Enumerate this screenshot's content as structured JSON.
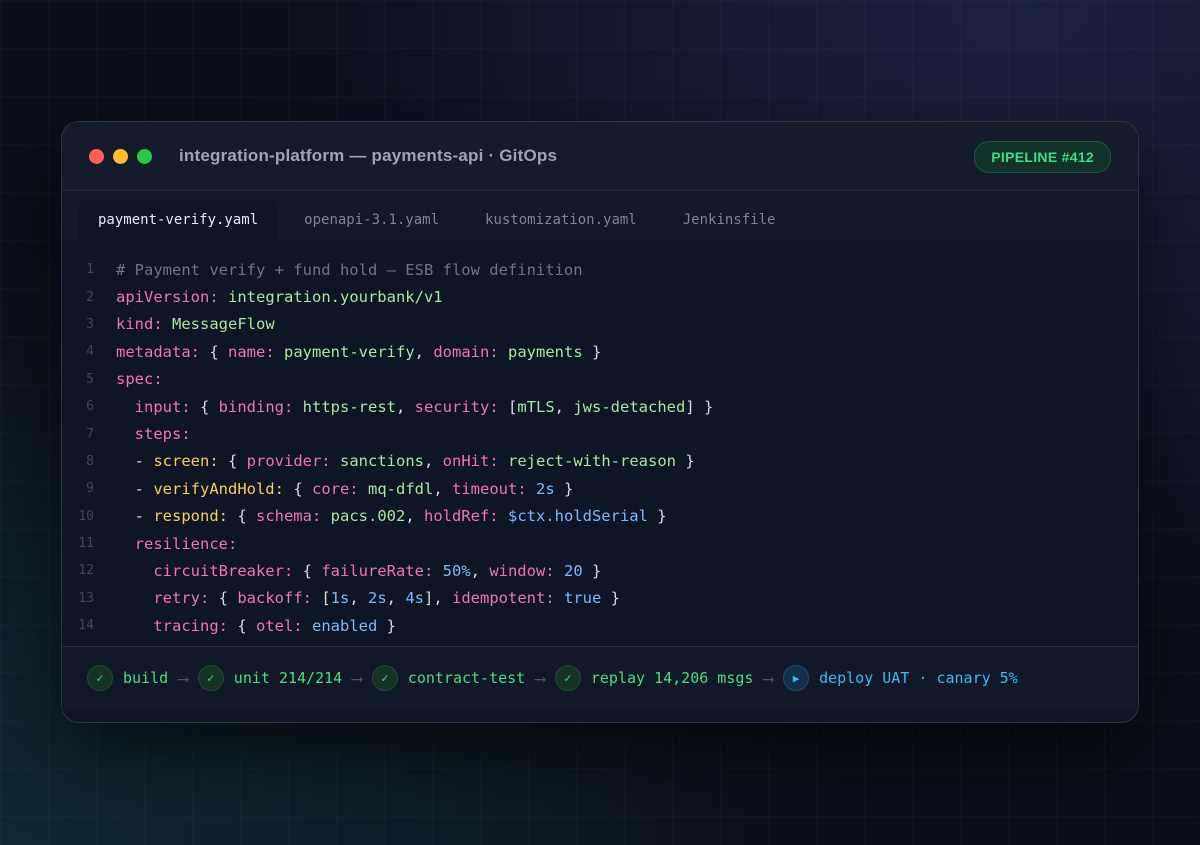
{
  "window": {
    "title": "integration-platform — payments-api · GitOps",
    "badge": "PIPELINE #412"
  },
  "tabs": [
    {
      "label": "payment-verify.yaml",
      "active": true
    },
    {
      "label": "openapi-3.1.yaml",
      "active": false
    },
    {
      "label": "kustomization.yaml",
      "active": false
    },
    {
      "label": "Jenkinsfile",
      "active": false
    }
  ],
  "code": {
    "line_numbers": [
      "1",
      "2",
      "3",
      "4",
      "5",
      "6",
      "7",
      "8",
      "9",
      "10",
      "11",
      "12",
      "13",
      "14"
    ],
    "lines": [
      [
        {
          "t": "comment",
          "v": "# Payment verify + fund hold — ESB flow definition"
        }
      ],
      [
        {
          "t": "key",
          "v": "apiVersion:"
        },
        {
          "t": "punc",
          "v": " "
        },
        {
          "t": "val",
          "v": "integration.yourbank/v1"
        }
      ],
      [
        {
          "t": "key",
          "v": "kind:"
        },
        {
          "t": "punc",
          "v": " "
        },
        {
          "t": "val",
          "v": "MessageFlow"
        }
      ],
      [
        {
          "t": "key",
          "v": "metadata:"
        },
        {
          "t": "punc",
          "v": " { "
        },
        {
          "t": "key",
          "v": "name:"
        },
        {
          "t": "punc",
          "v": " "
        },
        {
          "t": "val",
          "v": "payment-verify"
        },
        {
          "t": "punc",
          "v": ", "
        },
        {
          "t": "key",
          "v": "domain:"
        },
        {
          "t": "punc",
          "v": " "
        },
        {
          "t": "val",
          "v": "payments"
        },
        {
          "t": "punc",
          "v": " }"
        }
      ],
      [
        {
          "t": "key",
          "v": "spec:"
        }
      ],
      [
        {
          "t": "punc",
          "v": "  "
        },
        {
          "t": "key",
          "v": "input:"
        },
        {
          "t": "punc",
          "v": " { "
        },
        {
          "t": "key",
          "v": "binding:"
        },
        {
          "t": "punc",
          "v": " "
        },
        {
          "t": "val",
          "v": "https-rest"
        },
        {
          "t": "punc",
          "v": ", "
        },
        {
          "t": "key",
          "v": "security:"
        },
        {
          "t": "punc",
          "v": " ["
        },
        {
          "t": "val",
          "v": "mTLS"
        },
        {
          "t": "punc",
          "v": ", "
        },
        {
          "t": "val",
          "v": "jws-detached"
        },
        {
          "t": "punc",
          "v": "] }"
        }
      ],
      [
        {
          "t": "punc",
          "v": "  "
        },
        {
          "t": "key",
          "v": "steps:"
        }
      ],
      [
        {
          "t": "punc",
          "v": "  - "
        },
        {
          "t": "step",
          "v": "screen:"
        },
        {
          "t": "punc",
          "v": " { "
        },
        {
          "t": "key",
          "v": "provider:"
        },
        {
          "t": "punc",
          "v": " "
        },
        {
          "t": "val",
          "v": "sanctions"
        },
        {
          "t": "punc",
          "v": ", "
        },
        {
          "t": "key",
          "v": "onHit:"
        },
        {
          "t": "punc",
          "v": " "
        },
        {
          "t": "val",
          "v": "reject-with-reason"
        },
        {
          "t": "punc",
          "v": " }"
        }
      ],
      [
        {
          "t": "punc",
          "v": "  - "
        },
        {
          "t": "step",
          "v": "verifyAndHold:"
        },
        {
          "t": "punc",
          "v": " { "
        },
        {
          "t": "key",
          "v": "core:"
        },
        {
          "t": "punc",
          "v": " "
        },
        {
          "t": "val",
          "v": "mq-dfdl"
        },
        {
          "t": "punc",
          "v": ", "
        },
        {
          "t": "key",
          "v": "timeout:"
        },
        {
          "t": "punc",
          "v": " "
        },
        {
          "t": "num",
          "v": "2s"
        },
        {
          "t": "punc",
          "v": " }"
        }
      ],
      [
        {
          "t": "punc",
          "v": "  - "
        },
        {
          "t": "step",
          "v": "respond:"
        },
        {
          "t": "punc",
          "v": " { "
        },
        {
          "t": "key",
          "v": "schema:"
        },
        {
          "t": "punc",
          "v": " "
        },
        {
          "t": "val",
          "v": "pacs.002"
        },
        {
          "t": "punc",
          "v": ", "
        },
        {
          "t": "key",
          "v": "holdRef:"
        },
        {
          "t": "punc",
          "v": " "
        },
        {
          "t": "var",
          "v": "$ctx.holdSerial"
        },
        {
          "t": "punc",
          "v": " }"
        }
      ],
      [
        {
          "t": "punc",
          "v": "  "
        },
        {
          "t": "key",
          "v": "resilience:"
        }
      ],
      [
        {
          "t": "punc",
          "v": "    "
        },
        {
          "t": "key",
          "v": "circuitBreaker:"
        },
        {
          "t": "punc",
          "v": " { "
        },
        {
          "t": "key",
          "v": "failureRate:"
        },
        {
          "t": "punc",
          "v": " "
        },
        {
          "t": "num",
          "v": "50%"
        },
        {
          "t": "punc",
          "v": ", "
        },
        {
          "t": "key",
          "v": "window:"
        },
        {
          "t": "punc",
          "v": " "
        },
        {
          "t": "num",
          "v": "20"
        },
        {
          "t": "punc",
          "v": " }"
        }
      ],
      [
        {
          "t": "punc",
          "v": "    "
        },
        {
          "t": "key",
          "v": "retry:"
        },
        {
          "t": "punc",
          "v": " { "
        },
        {
          "t": "key",
          "v": "backoff:"
        },
        {
          "t": "punc",
          "v": " ["
        },
        {
          "t": "num",
          "v": "1s"
        },
        {
          "t": "punc",
          "v": ", "
        },
        {
          "t": "num",
          "v": "2s"
        },
        {
          "t": "punc",
          "v": ", "
        },
        {
          "t": "num",
          "v": "4s"
        },
        {
          "t": "punc",
          "v": "], "
        },
        {
          "t": "key",
          "v": "idempotent:"
        },
        {
          "t": "punc",
          "v": " "
        },
        {
          "t": "num",
          "v": "true"
        },
        {
          "t": "punc",
          "v": " }"
        }
      ],
      [
        {
          "t": "punc",
          "v": "    "
        },
        {
          "t": "key",
          "v": "tracing:"
        },
        {
          "t": "punc",
          "v": " { "
        },
        {
          "t": "key",
          "v": "otel:"
        },
        {
          "t": "punc",
          "v": " "
        },
        {
          "t": "num",
          "v": "enabled"
        },
        {
          "t": "punc",
          "v": " }"
        }
      ]
    ]
  },
  "pipeline": {
    "stages": [
      {
        "label": "build",
        "status": "ok",
        "icon": "check-icon",
        "glyph": "✓"
      },
      {
        "label": "unit 214/214",
        "status": "ok",
        "icon": "check-icon",
        "glyph": "✓"
      },
      {
        "label": "contract-test",
        "status": "ok",
        "icon": "check-icon",
        "glyph": "✓"
      },
      {
        "label": "replay 14,206 msgs",
        "status": "ok",
        "icon": "check-icon",
        "glyph": "✓"
      },
      {
        "label": "deploy UAT · canary 5%",
        "status": "run",
        "icon": "play-icon",
        "glyph": "▶"
      }
    ],
    "arrow": "⟶"
  },
  "colors": {
    "accent_green": "#3ddc84",
    "accent_blue": "#38bdf8",
    "key": "#f472b6",
    "value": "#a8e6a1",
    "step": "#facc5a",
    "number": "#7fb8ff"
  }
}
